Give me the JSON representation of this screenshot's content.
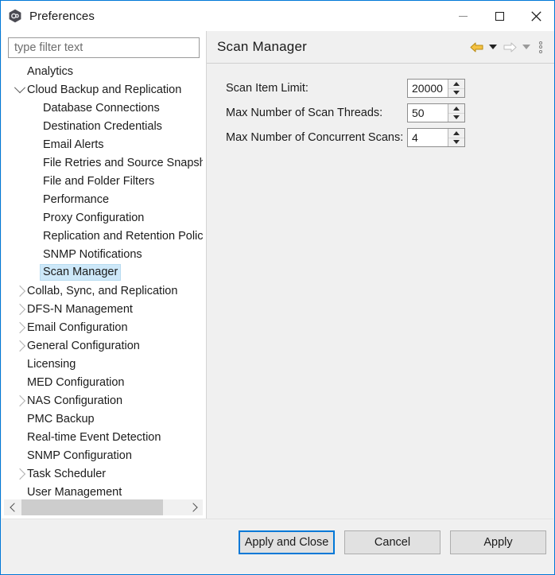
{
  "window": {
    "title": "Preferences",
    "icon": "app-hex-icon",
    "accent_color": "#0078d7",
    "controls": {
      "minimize": "minimize-icon",
      "maximize": "maximize-icon",
      "close": "close-icon"
    }
  },
  "filter": {
    "placeholder": "type filter text",
    "value": ""
  },
  "tree": {
    "selected": "Scan Manager",
    "selection_color": "#cde8f9",
    "items": [
      {
        "label": "Analytics",
        "level": 1,
        "twisty": "none"
      },
      {
        "label": "Cloud Backup and Replication",
        "level": 1,
        "twisty": "expanded"
      },
      {
        "label": "Database Connections",
        "level": 2,
        "twisty": "none"
      },
      {
        "label": "Destination Credentials",
        "level": 2,
        "twisty": "none"
      },
      {
        "label": "Email Alerts",
        "level": 2,
        "twisty": "none"
      },
      {
        "label": "File Retries and Source Snapshots",
        "level": 2,
        "twisty": "none"
      },
      {
        "label": "File and Folder Filters",
        "level": 2,
        "twisty": "none"
      },
      {
        "label": "Performance",
        "level": 2,
        "twisty": "none"
      },
      {
        "label": "Proxy Configuration",
        "level": 2,
        "twisty": "none"
      },
      {
        "label": "Replication and Retention Policy",
        "level": 2,
        "twisty": "none"
      },
      {
        "label": "SNMP Notifications",
        "level": 2,
        "twisty": "none"
      },
      {
        "label": "Scan Manager",
        "level": 2,
        "twisty": "none",
        "selected": true
      },
      {
        "label": "Collab, Sync, and Replication",
        "level": 1,
        "twisty": "collapsed"
      },
      {
        "label": "DFS-N Management",
        "level": 1,
        "twisty": "collapsed"
      },
      {
        "label": "Email Configuration",
        "level": 1,
        "twisty": "collapsed"
      },
      {
        "label": "General Configuration",
        "level": 1,
        "twisty": "collapsed"
      },
      {
        "label": "Licensing",
        "level": 1,
        "twisty": "none"
      },
      {
        "label": "MED Configuration",
        "level": 1,
        "twisty": "none"
      },
      {
        "label": "NAS Configuration",
        "level": 1,
        "twisty": "collapsed"
      },
      {
        "label": "PMC Backup",
        "level": 1,
        "twisty": "none"
      },
      {
        "label": "Real-time Event Detection",
        "level": 1,
        "twisty": "none"
      },
      {
        "label": "SNMP Configuration",
        "level": 1,
        "twisty": "none"
      },
      {
        "label": "Task Scheduler",
        "level": 1,
        "twisty": "collapsed"
      },
      {
        "label": "User Management",
        "level": 1,
        "twisty": "none"
      }
    ]
  },
  "scrollbar": {
    "left_arrow": "scroll-left-icon",
    "right_arrow": "scroll-right-icon"
  },
  "panel": {
    "title": "Scan Manager",
    "tools": {
      "back": "back-arrow-icon",
      "back_menu": "chevron-down-icon",
      "forward": "forward-arrow-icon",
      "forward_menu": "chevron-down-icon",
      "view_menu": "vertical-dots-icon",
      "back_color": "#e8a317",
      "forward_color": "#bdbdbd"
    },
    "fields": [
      {
        "label": "Scan Item Limit:",
        "value": "20000",
        "name": "scan-item-limit"
      },
      {
        "label": "Max Number of Scan Threads:",
        "value": "50",
        "name": "max-scan-threads"
      },
      {
        "label": "Max Number of Concurrent Scans:",
        "value": "4",
        "name": "max-concurrent-scans"
      }
    ]
  },
  "footer": {
    "apply_and_close": "Apply and Close",
    "cancel": "Cancel",
    "apply": "Apply"
  }
}
